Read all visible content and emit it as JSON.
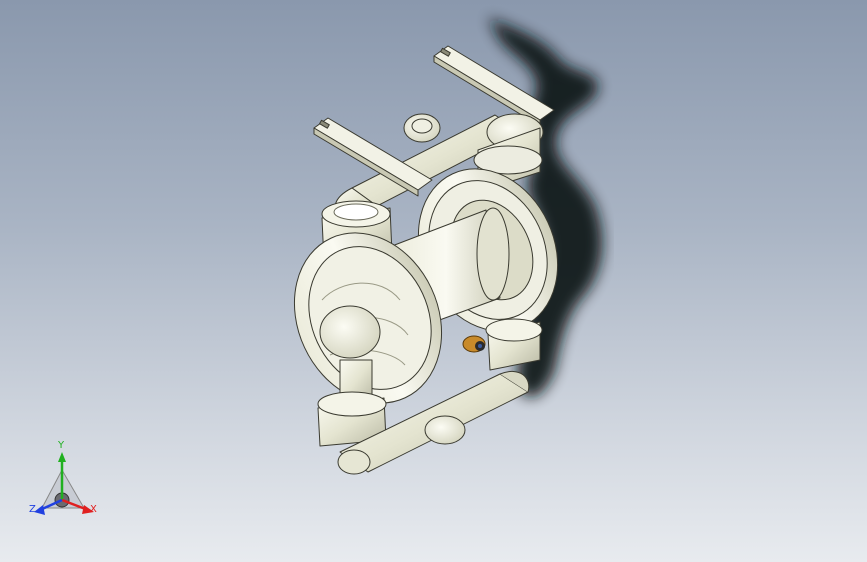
{
  "viewport": {
    "background_top": "#8a98ad",
    "background_bottom": "#e8ebef",
    "shadow_color": "#111318",
    "part_color": "#e6e6d2"
  },
  "model": {
    "icon": "diaphragm-pump-model-icon"
  },
  "triad": {
    "x_label": "X",
    "y_label": "Y",
    "z_label": "Z",
    "x_color": "#e02020",
    "y_color": "#20b020",
    "z_color": "#2040e0"
  },
  "fitting": {
    "icon": "brass-air-fitting-icon",
    "color": "#c88a2a"
  }
}
